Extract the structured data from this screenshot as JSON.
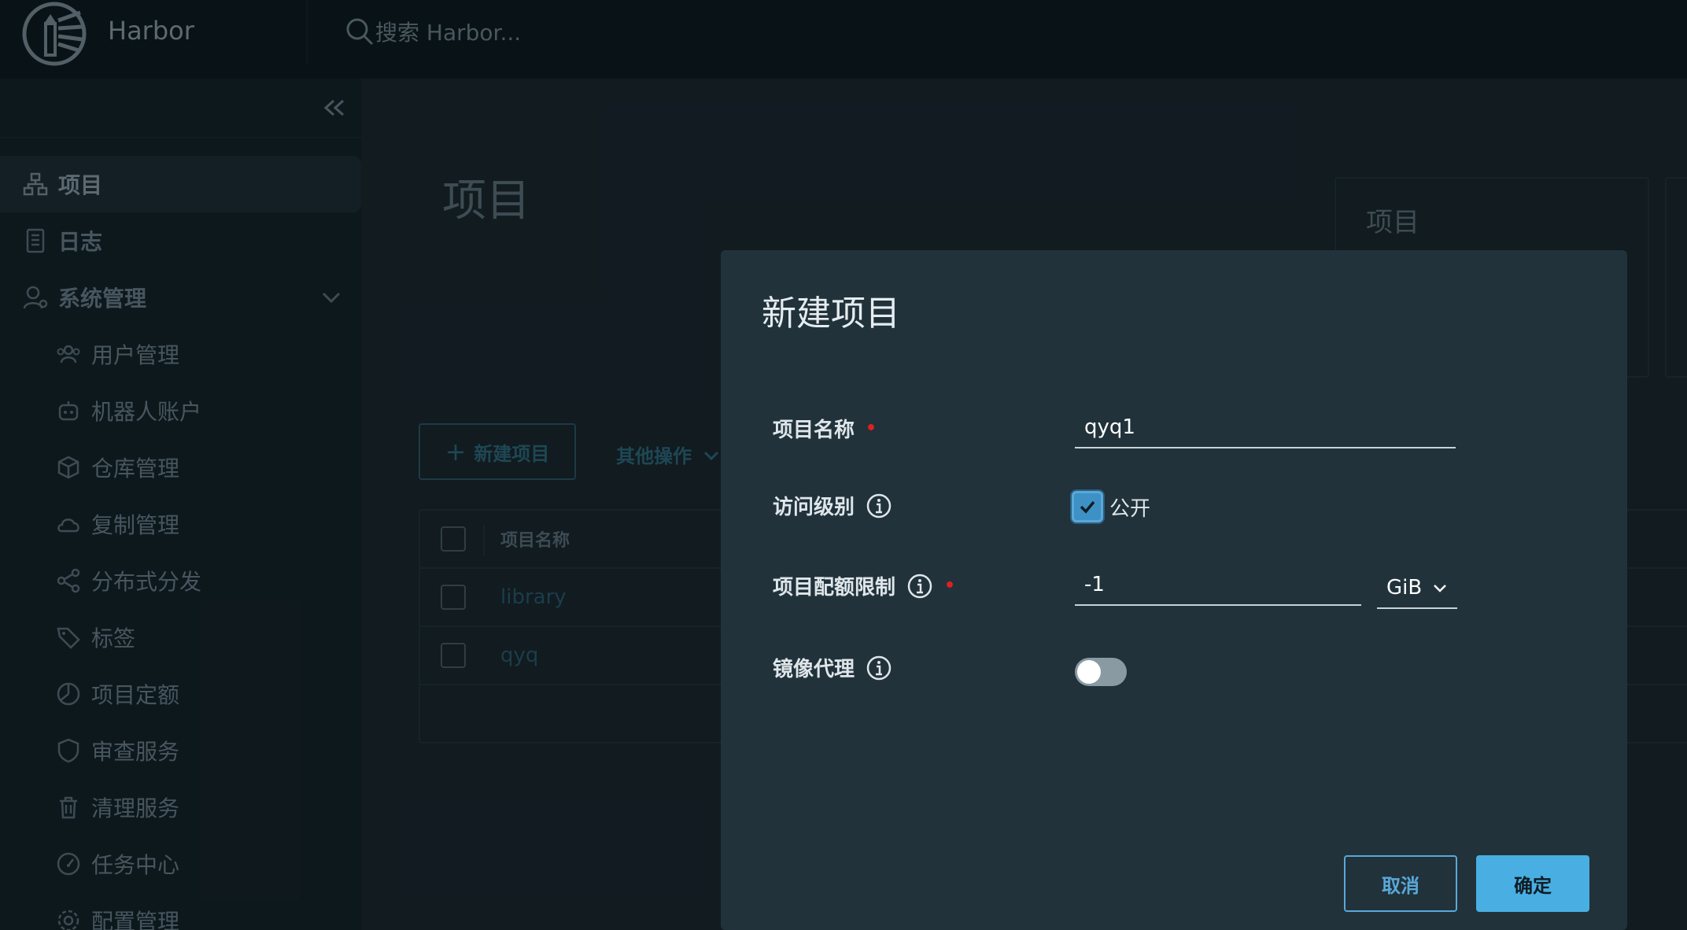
{
  "header": {
    "brand": "Harbor",
    "search_placeholder": "搜索 Harbor..."
  },
  "sidebar": {
    "items": [
      {
        "label": "项目",
        "icon": "projects-icon",
        "active": true
      },
      {
        "label": "日志",
        "icon": "logs-icon"
      },
      {
        "label": "系统管理",
        "icon": "admin-icon",
        "expandable": true
      },
      {
        "label": "用户管理",
        "icon": "users-icon"
      },
      {
        "label": "机器人账户",
        "icon": "robot-icon"
      },
      {
        "label": "仓库管理",
        "icon": "registry-icon"
      },
      {
        "label": "复制管理",
        "icon": "replication-icon"
      },
      {
        "label": "分布式分发",
        "icon": "distribution-icon"
      },
      {
        "label": "标签",
        "icon": "tag-icon"
      },
      {
        "label": "项目定额",
        "icon": "quota-icon"
      },
      {
        "label": "审查服务",
        "icon": "shield-icon"
      },
      {
        "label": "清理服务",
        "icon": "trash-icon"
      },
      {
        "label": "任务中心",
        "icon": "dashboard-icon"
      },
      {
        "label": "配置管理",
        "icon": "gear-icon"
      }
    ]
  },
  "main": {
    "title": "项目",
    "card_title": "项目",
    "new_project_label": "新建项目",
    "other_ops_label": "其他操作",
    "table": {
      "header": "项目名称",
      "rows": [
        "library",
        "qyq"
      ]
    }
  },
  "modal": {
    "title": "新建项目",
    "fields": {
      "name_label": "项目名称",
      "name_value": "qyq1",
      "access_label": "访问级别",
      "public_label": "公开",
      "public_checked": true,
      "quota_label": "项目配额限制",
      "quota_value": "-1",
      "quota_unit": "GiB",
      "proxy_label": "镜像代理",
      "proxy_enabled": false
    },
    "cancel_label": "取消",
    "ok_label": "确定"
  },
  "colors": {
    "accent": "#49afe2",
    "required": "#e02020",
    "modal_bg": "#21323b"
  }
}
